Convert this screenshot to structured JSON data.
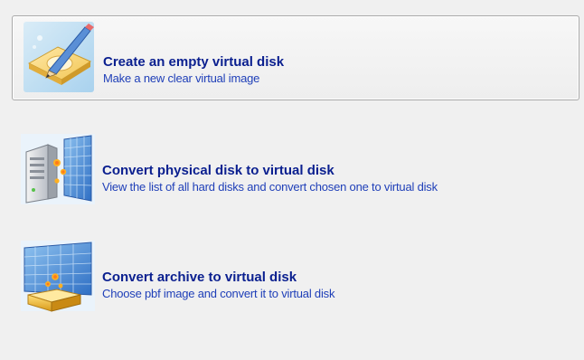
{
  "options": [
    {
      "title": "Create an empty virtual disk",
      "description": "Make a new clear virtual image",
      "icon": "pencil-disk-icon"
    },
    {
      "title": "Convert physical disk to virtual disk",
      "description": "View the list of all hard disks and convert chosen one to virtual disk",
      "icon": "server-to-virtual-icon"
    },
    {
      "title": "Convert archive to virtual disk",
      "description": "Choose pbf image and convert it to virtual disk",
      "icon": "archive-to-virtual-icon"
    }
  ],
  "colors": {
    "title": "#0a1f8f",
    "description": "#1f3fb8",
    "background": "#f0f0f0",
    "selection_border": "#a9a9a9"
  }
}
